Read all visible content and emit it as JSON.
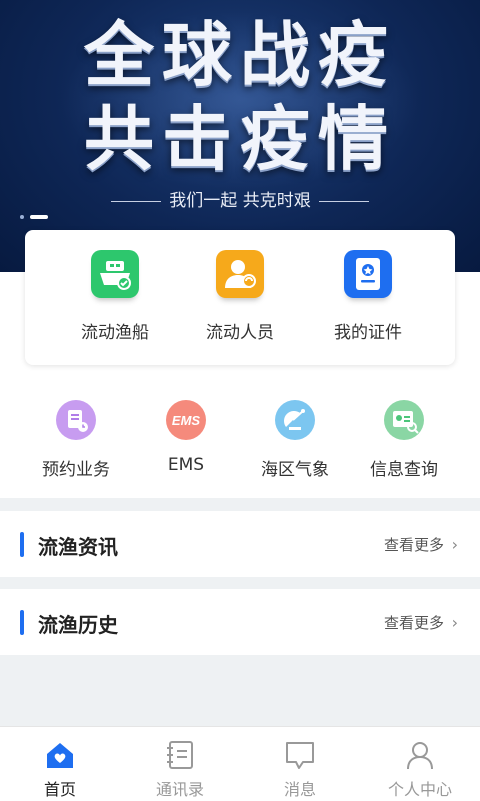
{
  "banner": {
    "title_line1": "全球战疫",
    "title_line2": "共击疫情",
    "subtitle": "我们一起 共克时艰",
    "carousel_pages": 2,
    "carousel_active": 2
  },
  "main_actions": [
    {
      "label": "流动渔船",
      "icon": "fishing-boat-icon",
      "color": "#2dc76d"
    },
    {
      "label": "流动人员",
      "icon": "person-icon",
      "color": "#f6a91b"
    },
    {
      "label": "我的证件",
      "icon": "id-document-icon",
      "color": "#1e6ef0"
    }
  ],
  "services": [
    {
      "label": "预约业务",
      "icon": "appointment-icon",
      "color": "#b07ee8"
    },
    {
      "label": "EMS",
      "icon": "ems-icon",
      "color": "#f06a5a"
    },
    {
      "label": "海区气象",
      "icon": "weather-radar-icon",
      "color": "#3aa8e8"
    },
    {
      "label": "信息查询",
      "icon": "info-query-icon",
      "color": "#4cc57a"
    }
  ],
  "sections": [
    {
      "title": "流渔资讯",
      "more": "查看更多"
    },
    {
      "title": "流渔历史",
      "more": "查看更多"
    }
  ],
  "bottom_nav": [
    {
      "label": "首页",
      "icon": "home-icon",
      "active": true
    },
    {
      "label": "通讯录",
      "icon": "contacts-icon",
      "active": false
    },
    {
      "label": "消息",
      "icon": "message-icon",
      "active": false
    },
    {
      "label": "个人中心",
      "icon": "profile-icon",
      "active": false
    }
  ],
  "colors": {
    "accent": "#1e6ef0",
    "banner_bg": "#0e2655"
  }
}
